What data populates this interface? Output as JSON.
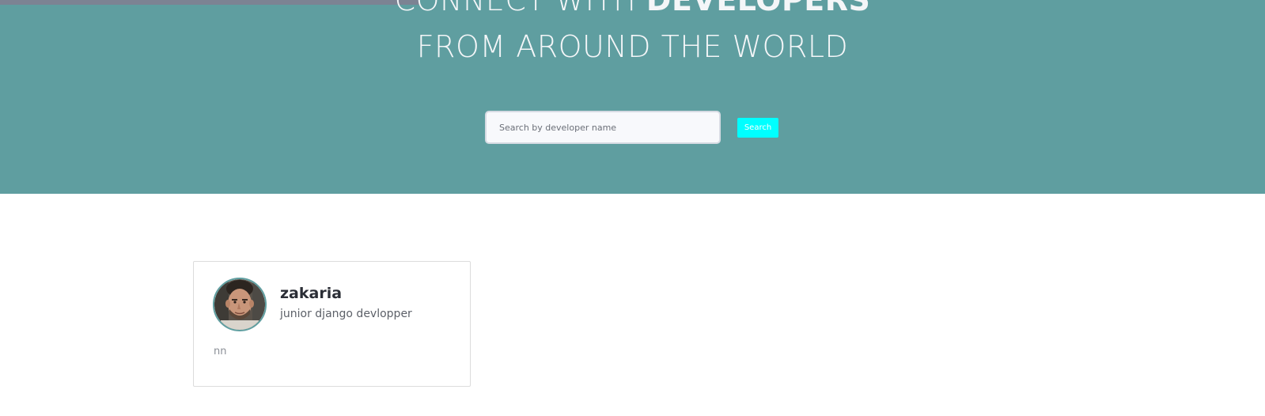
{
  "hero": {
    "headline_line1_prefix": "CONNECT WITH",
    "headline_line1_strong": "DEVELOPERS",
    "headline_line2": "FROM AROUND THE WORLD",
    "background_color": "#5f9ea0"
  },
  "search": {
    "placeholder": "Search by developer name",
    "value": "",
    "button_label": "Search",
    "button_color": "#00ffff"
  },
  "developers": [
    {
      "name": "zakaria",
      "title": "junior django devlopper",
      "bio": "nn",
      "avatar_icon": "profile-photo"
    }
  ]
}
